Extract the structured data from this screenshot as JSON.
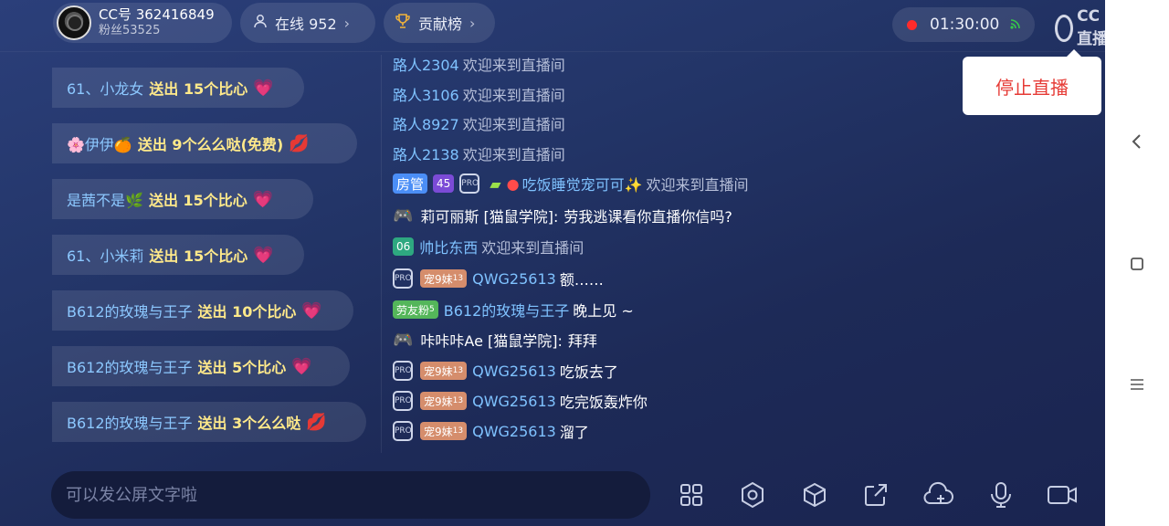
{
  "header": {
    "cc_id": "CC号 362416849",
    "fans": "粉丝53525",
    "online": "在线 952",
    "contrib": "贡献榜",
    "timer": "01:30:00",
    "logo": "CC直播",
    "stop_live": "停止直播"
  },
  "gifts": [
    {
      "user": "61、小龙女",
      "action": "送出 15个比心",
      "icon": "💗"
    },
    {
      "user": "🌸伊伊🍊",
      "action": "送出 9个么么哒(免费)",
      "icon": "💋"
    },
    {
      "user": "是茜不是🌿",
      "action": "送出 15个比心",
      "icon": "💗"
    },
    {
      "user": "61、小米莉",
      "action": "送出 15个比心",
      "icon": "💗"
    },
    {
      "user": "B612的玫瑰与王子",
      "action": "送出 10个比心",
      "icon": "💗"
    },
    {
      "user": "B612的玫瑰与王子",
      "action": "送出 5个比心",
      "icon": "💗"
    },
    {
      "user": "B612的玫瑰与王子",
      "action": "送出 3个么么哒",
      "icon": "💋"
    }
  ],
  "chat": {
    "welcome_text": "欢迎来到直播间",
    "visitors": [
      "路人2304",
      "路人3106",
      "路人8927",
      "路人2138"
    ],
    "admin_badge": "房管",
    "level_45": "45",
    "vip_user": "吃饭睡觉宠可可✨",
    "game_user1": "莉可丽斯 [猫鼠学院]:",
    "game_msg1": "劳我逃课看你直播你信吗?",
    "level_06": "06",
    "user_06": "帅比东西",
    "pet_badge": "宠9妹",
    "pet_level": "13",
    "pet_user": "QWG25613",
    "msg_e": "额……",
    "fan_badge": "劳友粉",
    "fan_level": "5",
    "fan_user": "B612的玫瑰与王子",
    "msg_night": "晚上见 ~",
    "game_user2": "咔咔咔Ae [猫鼠学院]:",
    "game_msg2": "拜拜",
    "msg_eat": "吃饭去了",
    "msg_bomb": "吃完饭轰炸你",
    "msg_slip": "溜了",
    "shield_text": "PRO"
  },
  "input": {
    "placeholder": "可以发公屏文字啦"
  }
}
